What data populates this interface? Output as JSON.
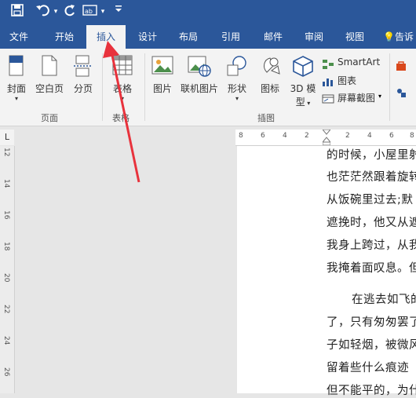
{
  "qat": {
    "save_icon": "save-icon",
    "undo_icon": "undo-icon",
    "redo_icon": "repeat-icon",
    "form_icon": "form-field-icon",
    "customize_icon": "customize-qat-icon"
  },
  "tabs": [
    {
      "label": "文件"
    },
    {
      "label": "开始"
    },
    {
      "label": "插入"
    },
    {
      "label": "设计"
    },
    {
      "label": "布局"
    },
    {
      "label": "引用"
    },
    {
      "label": "邮件"
    },
    {
      "label": "审阅"
    },
    {
      "label": "视图"
    },
    {
      "label": "告诉"
    }
  ],
  "ribbon": {
    "pages": {
      "cover": "封面",
      "blank": "空白页",
      "break": "分页",
      "group": "页面"
    },
    "tables": {
      "table": "表格",
      "group": "表格"
    },
    "illustrations": {
      "picture": "图片",
      "online_picture": "联机图片",
      "shapes": "形状",
      "icons": "图标",
      "model_line1": "3D 模",
      "model_line2": "型",
      "smartart": "SmartArt",
      "chart": "图表",
      "screenshot": "屏幕截图",
      "group": "插图"
    }
  },
  "ruler": {
    "horizontal_ticks": [
      "8",
      "6",
      "4",
      "2",
      "2",
      "4",
      "6",
      "8"
    ],
    "vertical_ticks": [
      "12",
      "14",
      "16",
      "18",
      "20",
      "22",
      "24",
      "26"
    ]
  },
  "document": {
    "lines": [
      "的时候，小屋里射",
      "也茫茫然跟着旋转",
      "从饭碗里过去;默",
      "遮挽时，他又从遮",
      "我身上跨过，从我",
      "我掩着面叹息。但",
      "在逃去如飞的",
      "了，只有匆匆罢了",
      "子如轻烟，被微风",
      "留着些什么痕迹",
      "但不能平的，为什"
    ]
  },
  "colors": {
    "brand": "#2b579a",
    "arrow": "#e8323c"
  }
}
